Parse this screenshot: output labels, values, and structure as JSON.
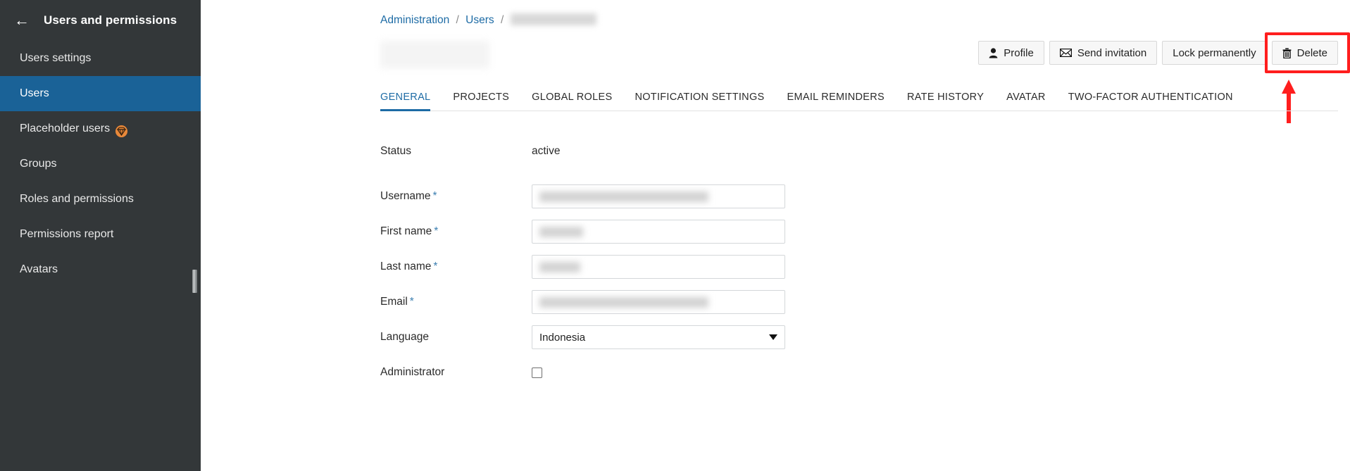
{
  "sidebar": {
    "back_icon": "arrow-left-icon",
    "title": "Users and permissions",
    "items": [
      {
        "label": "Users settings",
        "active": false,
        "badge": null
      },
      {
        "label": "Users",
        "active": true,
        "badge": null
      },
      {
        "label": "Placeholder users",
        "active": false,
        "badge": "enterprise-globe-icon"
      },
      {
        "label": "Groups",
        "active": false,
        "badge": null
      },
      {
        "label": "Roles and permissions",
        "active": false,
        "badge": null
      },
      {
        "label": "Permissions report",
        "active": false,
        "badge": null
      },
      {
        "label": "Avatars",
        "active": false,
        "badge": null
      }
    ],
    "colors": {
      "background": "#333739",
      "active": "#1a6297",
      "text": "#e9e9e9",
      "badge": "#e8883a"
    }
  },
  "breadcrumb": {
    "item1": "Administration",
    "sep1": "/",
    "item2": "Users",
    "sep2": "/",
    "item3_redacted": ""
  },
  "page_title_redacted": "",
  "toolbar": {
    "profile_label": "Profile",
    "profile_icon": "user-icon",
    "send_invitation_label": "Send invitation",
    "send_invitation_icon": "envelope-icon",
    "lock_permanently_label": "Lock permanently",
    "delete_label": "Delete",
    "delete_icon": "trash-icon",
    "highlight_color": "#ff1e1e"
  },
  "tabs": [
    {
      "label": "GENERAL",
      "active": true
    },
    {
      "label": "PROJECTS",
      "active": false
    },
    {
      "label": "GLOBAL ROLES",
      "active": false
    },
    {
      "label": "NOTIFICATION SETTINGS",
      "active": false
    },
    {
      "label": "EMAIL REMINDERS",
      "active": false
    },
    {
      "label": "RATE HISTORY",
      "active": false
    },
    {
      "label": "AVATAR",
      "active": false
    },
    {
      "label": "TWO-FACTOR AUTHENTICATION",
      "active": false
    }
  ],
  "form": {
    "status": {
      "label": "Status",
      "value": "active"
    },
    "username": {
      "label": "Username",
      "required_marker": "*",
      "value_redacted": ""
    },
    "first_name": {
      "label": "First name",
      "required_marker": "*",
      "value_redacted": ""
    },
    "last_name": {
      "label": "Last name",
      "required_marker": "*",
      "value_redacted": ""
    },
    "email": {
      "label": "Email",
      "required_marker": "*",
      "value_redacted": ""
    },
    "language": {
      "label": "Language",
      "value": "Indonesia",
      "caret_icon": "chevron-down-icon"
    },
    "administrator": {
      "label": "Administrator",
      "checked": false
    }
  }
}
